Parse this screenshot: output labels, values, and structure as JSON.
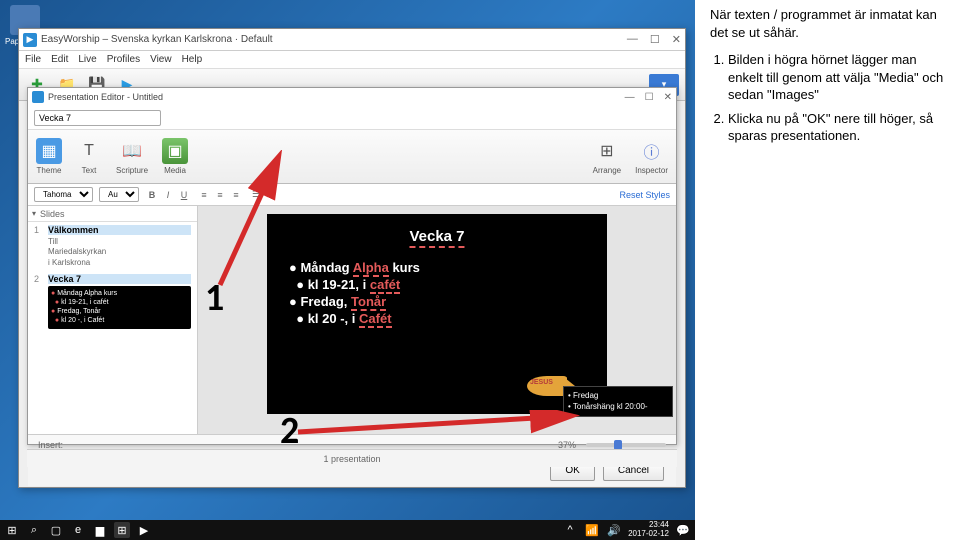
{
  "desktop": {
    "icon1_label": "Papperskorg"
  },
  "main": {
    "title": "EasyWorship – Svenska kyrkan Karlskrona · Default",
    "menu": [
      "File",
      "Edit",
      "Live",
      "Profiles",
      "View",
      "Help"
    ],
    "toolbar_dd": "▾"
  },
  "editor": {
    "title": "Presentation Editor - Untitled",
    "search_value": "Vecka 7",
    "ribbon": {
      "theme": "Theme",
      "text": "Text",
      "scripture": "Scripture",
      "media": "Media",
      "arrange": "Arrange",
      "inspector": "Inspector"
    },
    "format": {
      "font": "Tahoma",
      "size": "Auto",
      "reset": "Reset Styles"
    },
    "slides_label": "Slides",
    "slides": [
      {
        "num": "1",
        "title": "Välkommen",
        "lines": [
          "Till",
          "Mariedalskyrkan",
          "i Karlskrona"
        ]
      },
      {
        "num": "2",
        "title": "Vecka 7",
        "lines": [
          "Måndag Alpha kurs",
          "kl 19-21, i cafét",
          "Fredag, Tonår",
          "kl 20 -, i Cafét"
        ]
      }
    ],
    "canvas": {
      "title": "Vecka 7",
      "l1": "Måndag Alpha kurs",
      "l1u": "Alpha",
      "l2": "kl 19-21, i cafét",
      "l2u": "cafét",
      "l3": "Fredag, Tonår",
      "l3u": "Tonår",
      "l4": "kl 20 -, i Cafét",
      "l4u": "Cafét",
      "fish": "JESUS"
    },
    "insert_label": "Insert:",
    "zoom": "37%",
    "ok": "OK",
    "cancel": "Cancel"
  },
  "schedule": {
    "l1": "• Fredag",
    "l2": "• Tonårshäng kl 20:00-"
  },
  "status": {
    "presentations": "1 presentation"
  },
  "callouts": {
    "n1": "1",
    "n2": "2"
  },
  "instructions": {
    "intro": "När texten / programmet är inmatat kan det se ut såhär.",
    "i1": "Bilden i högra hörnet lägger man enkelt till genom att välja \"Media\" och sedan \"Images\"",
    "i2": "Klicka nu på \"OK\" nere till höger, så sparas presentationen."
  },
  "taskbar": {
    "time": "23:44",
    "date": "2017-02-12"
  }
}
